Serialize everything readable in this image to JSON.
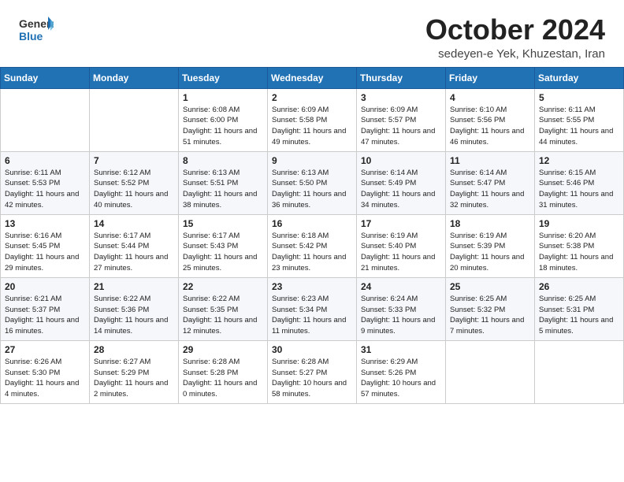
{
  "header": {
    "logo_general": "General",
    "logo_blue": "Blue",
    "month_title": "October 2024",
    "location": "sedeyen-e Yek, Khuzestan, Iran"
  },
  "weekdays": [
    "Sunday",
    "Monday",
    "Tuesday",
    "Wednesday",
    "Thursday",
    "Friday",
    "Saturday"
  ],
  "weeks": [
    [
      {
        "day": "",
        "empty": true
      },
      {
        "day": "",
        "empty": true
      },
      {
        "day": "1",
        "sunrise": "6:08 AM",
        "sunset": "6:00 PM",
        "daylight": "11 hours and 51 minutes."
      },
      {
        "day": "2",
        "sunrise": "6:09 AM",
        "sunset": "5:58 PM",
        "daylight": "11 hours and 49 minutes."
      },
      {
        "day": "3",
        "sunrise": "6:09 AM",
        "sunset": "5:57 PM",
        "daylight": "11 hours and 47 minutes."
      },
      {
        "day": "4",
        "sunrise": "6:10 AM",
        "sunset": "5:56 PM",
        "daylight": "11 hours and 46 minutes."
      },
      {
        "day": "5",
        "sunrise": "6:11 AM",
        "sunset": "5:55 PM",
        "daylight": "11 hours and 44 minutes."
      }
    ],
    [
      {
        "day": "6",
        "sunrise": "6:11 AM",
        "sunset": "5:53 PM",
        "daylight": "11 hours and 42 minutes."
      },
      {
        "day": "7",
        "sunrise": "6:12 AM",
        "sunset": "5:52 PM",
        "daylight": "11 hours and 40 minutes."
      },
      {
        "day": "8",
        "sunrise": "6:13 AM",
        "sunset": "5:51 PM",
        "daylight": "11 hours and 38 minutes."
      },
      {
        "day": "9",
        "sunrise": "6:13 AM",
        "sunset": "5:50 PM",
        "daylight": "11 hours and 36 minutes."
      },
      {
        "day": "10",
        "sunrise": "6:14 AM",
        "sunset": "5:49 PM",
        "daylight": "11 hours and 34 minutes."
      },
      {
        "day": "11",
        "sunrise": "6:14 AM",
        "sunset": "5:47 PM",
        "daylight": "11 hours and 32 minutes."
      },
      {
        "day": "12",
        "sunrise": "6:15 AM",
        "sunset": "5:46 PM",
        "daylight": "11 hours and 31 minutes."
      }
    ],
    [
      {
        "day": "13",
        "sunrise": "6:16 AM",
        "sunset": "5:45 PM",
        "daylight": "11 hours and 29 minutes."
      },
      {
        "day": "14",
        "sunrise": "6:17 AM",
        "sunset": "5:44 PM",
        "daylight": "11 hours and 27 minutes."
      },
      {
        "day": "15",
        "sunrise": "6:17 AM",
        "sunset": "5:43 PM",
        "daylight": "11 hours and 25 minutes."
      },
      {
        "day": "16",
        "sunrise": "6:18 AM",
        "sunset": "5:42 PM",
        "daylight": "11 hours and 23 minutes."
      },
      {
        "day": "17",
        "sunrise": "6:19 AM",
        "sunset": "5:40 PM",
        "daylight": "11 hours and 21 minutes."
      },
      {
        "day": "18",
        "sunrise": "6:19 AM",
        "sunset": "5:39 PM",
        "daylight": "11 hours and 20 minutes."
      },
      {
        "day": "19",
        "sunrise": "6:20 AM",
        "sunset": "5:38 PM",
        "daylight": "11 hours and 18 minutes."
      }
    ],
    [
      {
        "day": "20",
        "sunrise": "6:21 AM",
        "sunset": "5:37 PM",
        "daylight": "11 hours and 16 minutes."
      },
      {
        "day": "21",
        "sunrise": "6:22 AM",
        "sunset": "5:36 PM",
        "daylight": "11 hours and 14 minutes."
      },
      {
        "day": "22",
        "sunrise": "6:22 AM",
        "sunset": "5:35 PM",
        "daylight": "11 hours and 12 minutes."
      },
      {
        "day": "23",
        "sunrise": "6:23 AM",
        "sunset": "5:34 PM",
        "daylight": "11 hours and 11 minutes."
      },
      {
        "day": "24",
        "sunrise": "6:24 AM",
        "sunset": "5:33 PM",
        "daylight": "11 hours and 9 minutes."
      },
      {
        "day": "25",
        "sunrise": "6:25 AM",
        "sunset": "5:32 PM",
        "daylight": "11 hours and 7 minutes."
      },
      {
        "day": "26",
        "sunrise": "6:25 AM",
        "sunset": "5:31 PM",
        "daylight": "11 hours and 5 minutes."
      }
    ],
    [
      {
        "day": "27",
        "sunrise": "6:26 AM",
        "sunset": "5:30 PM",
        "daylight": "11 hours and 4 minutes."
      },
      {
        "day": "28",
        "sunrise": "6:27 AM",
        "sunset": "5:29 PM",
        "daylight": "11 hours and 2 minutes."
      },
      {
        "day": "29",
        "sunrise": "6:28 AM",
        "sunset": "5:28 PM",
        "daylight": "11 hours and 0 minutes."
      },
      {
        "day": "30",
        "sunrise": "6:28 AM",
        "sunset": "5:27 PM",
        "daylight": "10 hours and 58 minutes."
      },
      {
        "day": "31",
        "sunrise": "6:29 AM",
        "sunset": "5:26 PM",
        "daylight": "10 hours and 57 minutes."
      },
      {
        "day": "",
        "empty": true
      },
      {
        "day": "",
        "empty": true
      }
    ]
  ]
}
